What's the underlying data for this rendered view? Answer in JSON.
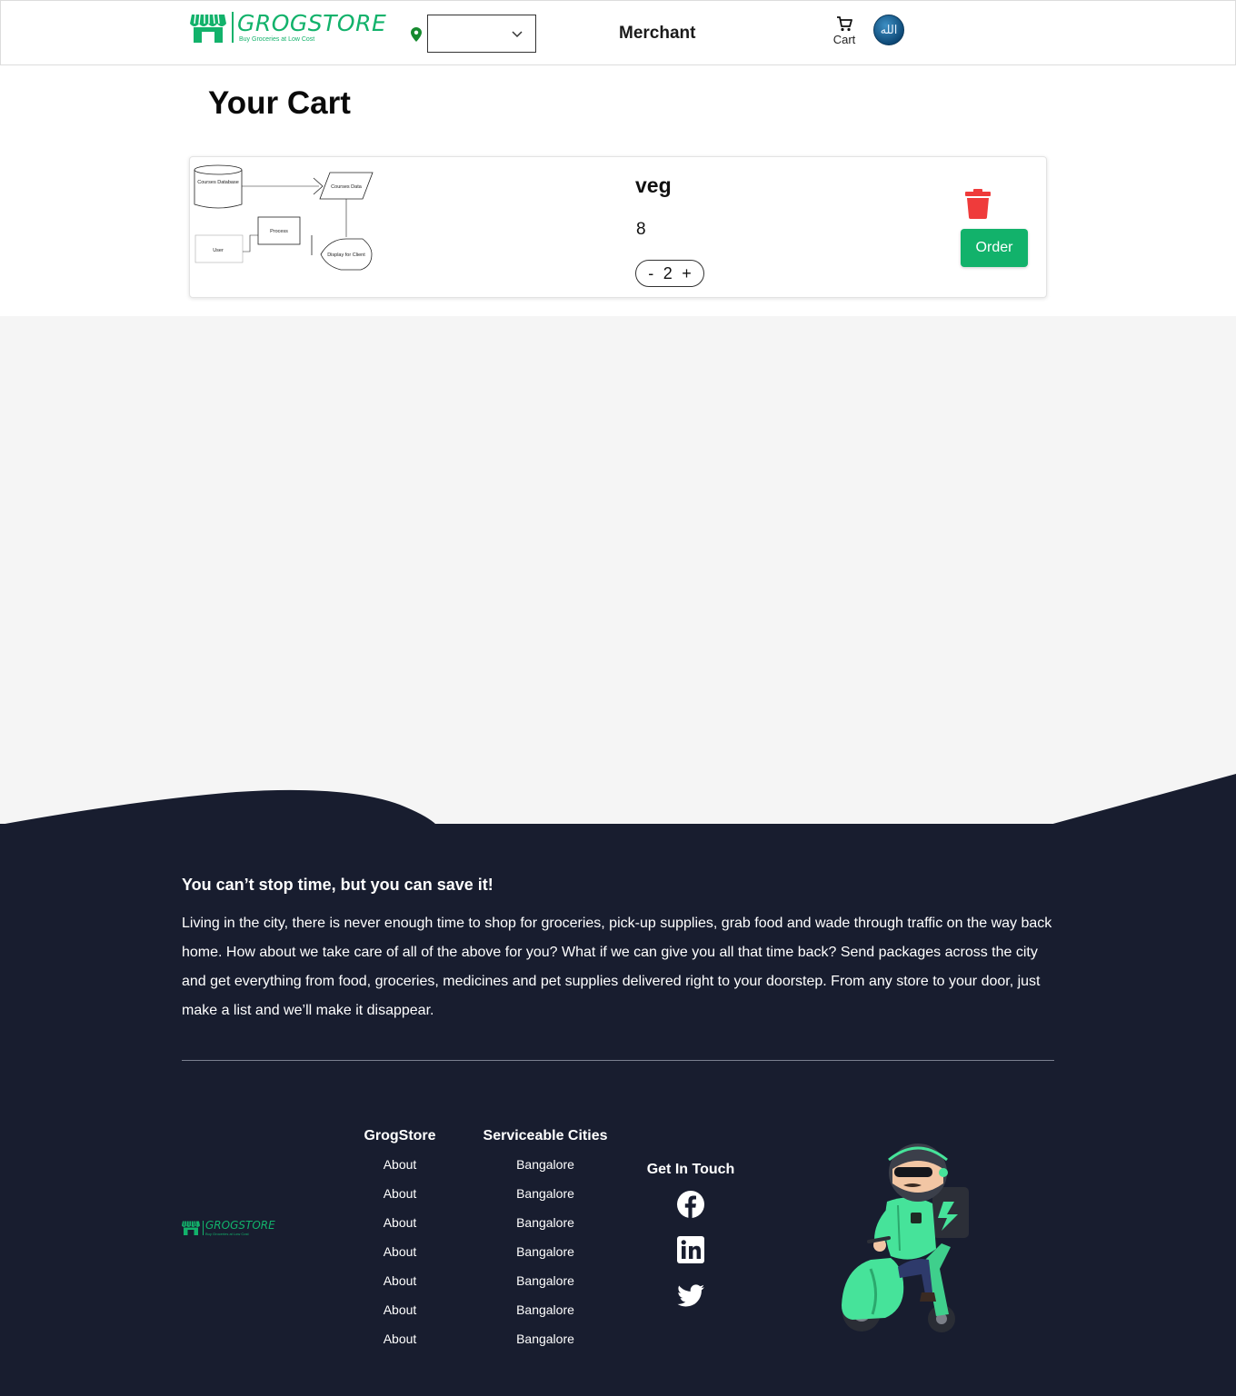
{
  "header": {
    "brand_name": "GROGSTORE",
    "brand_tagline": "Buy Groceries at Low Cost",
    "location_value": "",
    "merchant_label": "Merchant",
    "cart_label": "Cart",
    "avatar_glyph": "الله"
  },
  "cart": {
    "title": "Your Cart",
    "items": [
      {
        "name": "veg",
        "price": "8",
        "quantity": "2",
        "decrement": "-",
        "increment": "+",
        "order_label": "Order",
        "image": {
          "nodes": [
            "Courses Database",
            "Courses Data",
            "Process",
            "User",
            "Display for Client"
          ]
        }
      }
    ]
  },
  "footer": {
    "tagline": "You can’t stop time, but you can save it!",
    "about": "Living in the city, there is never enough time to shop for groceries, pick-up supplies, grab food and wade through traffic on the way back home. How about we take care of all of the above for you? What if we can give you all that time back? Send packages across the city and get everything from food, groceries, medicines and pet supplies delivered right to your doorstep. From any store to your door, just make a list and we’ll make it disappear.",
    "brand_name": "GROGSTORE",
    "brand_tagline": "Buy Groceries at Low Cost",
    "columns": {
      "grogstore": {
        "heading": "GrogStore",
        "links": [
          "About",
          "About",
          "About",
          "About",
          "About",
          "About",
          "About"
        ]
      },
      "cities": {
        "heading": "Serviceable Cities",
        "links": [
          "Bangalore",
          "Bangalore",
          "Bangalore",
          "Bangalore",
          "Bangalore",
          "Bangalore",
          "Bangalore"
        ]
      },
      "touch": {
        "heading": "Get In Touch",
        "social": [
          "facebook-icon",
          "linkedin-icon",
          "twitter-icon"
        ]
      }
    }
  },
  "colors": {
    "brand_green": "#12b26b",
    "footer_bg": "#181d2f",
    "trash_red": "#ef3b3b",
    "page_grey": "#f5f5f5"
  }
}
